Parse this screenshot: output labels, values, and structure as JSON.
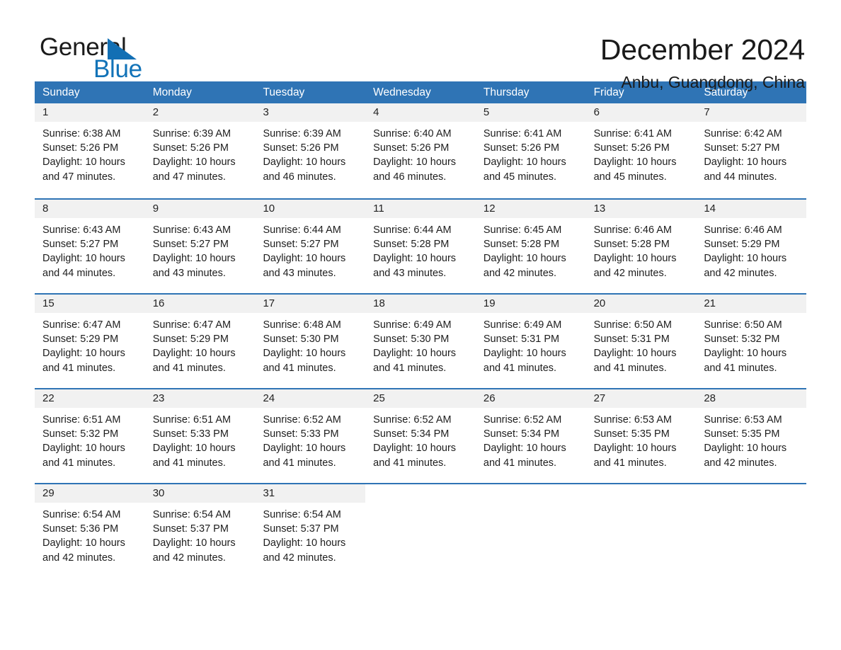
{
  "brand": {
    "word_one": "General",
    "word_two": "Blue",
    "triangle_color": "#126fb4",
    "blue_text_color": "#1273b8"
  },
  "header": {
    "month_title": "December 2024",
    "location": "Anbu, Guangdong, China"
  },
  "colors": {
    "header_blue": "#2f74b5",
    "day_band_gray": "#f1f1f1",
    "text": "#1d1d1d"
  },
  "calendar": {
    "weekdays": [
      "Sunday",
      "Monday",
      "Tuesday",
      "Wednesday",
      "Thursday",
      "Friday",
      "Saturday"
    ],
    "weeks": [
      [
        {
          "day": "1",
          "sunrise": "Sunrise: 6:38 AM",
          "sunset": "Sunset: 5:26 PM",
          "daylight_line1": "Daylight: 10 hours",
          "daylight_line2": "and 47 minutes."
        },
        {
          "day": "2",
          "sunrise": "Sunrise: 6:39 AM",
          "sunset": "Sunset: 5:26 PM",
          "daylight_line1": "Daylight: 10 hours",
          "daylight_line2": "and 47 minutes."
        },
        {
          "day": "3",
          "sunrise": "Sunrise: 6:39 AM",
          "sunset": "Sunset: 5:26 PM",
          "daylight_line1": "Daylight: 10 hours",
          "daylight_line2": "and 46 minutes."
        },
        {
          "day": "4",
          "sunrise": "Sunrise: 6:40 AM",
          "sunset": "Sunset: 5:26 PM",
          "daylight_line1": "Daylight: 10 hours",
          "daylight_line2": "and 46 minutes."
        },
        {
          "day": "5",
          "sunrise": "Sunrise: 6:41 AM",
          "sunset": "Sunset: 5:26 PM",
          "daylight_line1": "Daylight: 10 hours",
          "daylight_line2": "and 45 minutes."
        },
        {
          "day": "6",
          "sunrise": "Sunrise: 6:41 AM",
          "sunset": "Sunset: 5:26 PM",
          "daylight_line1": "Daylight: 10 hours",
          "daylight_line2": "and 45 minutes."
        },
        {
          "day": "7",
          "sunrise": "Sunrise: 6:42 AM",
          "sunset": "Sunset: 5:27 PM",
          "daylight_line1": "Daylight: 10 hours",
          "daylight_line2": "and 44 minutes."
        }
      ],
      [
        {
          "day": "8",
          "sunrise": "Sunrise: 6:43 AM",
          "sunset": "Sunset: 5:27 PM",
          "daylight_line1": "Daylight: 10 hours",
          "daylight_line2": "and 44 minutes."
        },
        {
          "day": "9",
          "sunrise": "Sunrise: 6:43 AM",
          "sunset": "Sunset: 5:27 PM",
          "daylight_line1": "Daylight: 10 hours",
          "daylight_line2": "and 43 minutes."
        },
        {
          "day": "10",
          "sunrise": "Sunrise: 6:44 AM",
          "sunset": "Sunset: 5:27 PM",
          "daylight_line1": "Daylight: 10 hours",
          "daylight_line2": "and 43 minutes."
        },
        {
          "day": "11",
          "sunrise": "Sunrise: 6:44 AM",
          "sunset": "Sunset: 5:28 PM",
          "daylight_line1": "Daylight: 10 hours",
          "daylight_line2": "and 43 minutes."
        },
        {
          "day": "12",
          "sunrise": "Sunrise: 6:45 AM",
          "sunset": "Sunset: 5:28 PM",
          "daylight_line1": "Daylight: 10 hours",
          "daylight_line2": "and 42 minutes."
        },
        {
          "day": "13",
          "sunrise": "Sunrise: 6:46 AM",
          "sunset": "Sunset: 5:28 PM",
          "daylight_line1": "Daylight: 10 hours",
          "daylight_line2": "and 42 minutes."
        },
        {
          "day": "14",
          "sunrise": "Sunrise: 6:46 AM",
          "sunset": "Sunset: 5:29 PM",
          "daylight_line1": "Daylight: 10 hours",
          "daylight_line2": "and 42 minutes."
        }
      ],
      [
        {
          "day": "15",
          "sunrise": "Sunrise: 6:47 AM",
          "sunset": "Sunset: 5:29 PM",
          "daylight_line1": "Daylight: 10 hours",
          "daylight_line2": "and 41 minutes."
        },
        {
          "day": "16",
          "sunrise": "Sunrise: 6:47 AM",
          "sunset": "Sunset: 5:29 PM",
          "daylight_line1": "Daylight: 10 hours",
          "daylight_line2": "and 41 minutes."
        },
        {
          "day": "17",
          "sunrise": "Sunrise: 6:48 AM",
          "sunset": "Sunset: 5:30 PM",
          "daylight_line1": "Daylight: 10 hours",
          "daylight_line2": "and 41 minutes."
        },
        {
          "day": "18",
          "sunrise": "Sunrise: 6:49 AM",
          "sunset": "Sunset: 5:30 PM",
          "daylight_line1": "Daylight: 10 hours",
          "daylight_line2": "and 41 minutes."
        },
        {
          "day": "19",
          "sunrise": "Sunrise: 6:49 AM",
          "sunset": "Sunset: 5:31 PM",
          "daylight_line1": "Daylight: 10 hours",
          "daylight_line2": "and 41 minutes."
        },
        {
          "day": "20",
          "sunrise": "Sunrise: 6:50 AM",
          "sunset": "Sunset: 5:31 PM",
          "daylight_line1": "Daylight: 10 hours",
          "daylight_line2": "and 41 minutes."
        },
        {
          "day": "21",
          "sunrise": "Sunrise: 6:50 AM",
          "sunset": "Sunset: 5:32 PM",
          "daylight_line1": "Daylight: 10 hours",
          "daylight_line2": "and 41 minutes."
        }
      ],
      [
        {
          "day": "22",
          "sunrise": "Sunrise: 6:51 AM",
          "sunset": "Sunset: 5:32 PM",
          "daylight_line1": "Daylight: 10 hours",
          "daylight_line2": "and 41 minutes."
        },
        {
          "day": "23",
          "sunrise": "Sunrise: 6:51 AM",
          "sunset": "Sunset: 5:33 PM",
          "daylight_line1": "Daylight: 10 hours",
          "daylight_line2": "and 41 minutes."
        },
        {
          "day": "24",
          "sunrise": "Sunrise: 6:52 AM",
          "sunset": "Sunset: 5:33 PM",
          "daylight_line1": "Daylight: 10 hours",
          "daylight_line2": "and 41 minutes."
        },
        {
          "day": "25",
          "sunrise": "Sunrise: 6:52 AM",
          "sunset": "Sunset: 5:34 PM",
          "daylight_line1": "Daylight: 10 hours",
          "daylight_line2": "and 41 minutes."
        },
        {
          "day": "26",
          "sunrise": "Sunrise: 6:52 AM",
          "sunset": "Sunset: 5:34 PM",
          "daylight_line1": "Daylight: 10 hours",
          "daylight_line2": "and 41 minutes."
        },
        {
          "day": "27",
          "sunrise": "Sunrise: 6:53 AM",
          "sunset": "Sunset: 5:35 PM",
          "daylight_line1": "Daylight: 10 hours",
          "daylight_line2": "and 41 minutes."
        },
        {
          "day": "28",
          "sunrise": "Sunrise: 6:53 AM",
          "sunset": "Sunset: 5:35 PM",
          "daylight_line1": "Daylight: 10 hours",
          "daylight_line2": "and 42 minutes."
        }
      ],
      [
        {
          "day": "29",
          "sunrise": "Sunrise: 6:54 AM",
          "sunset": "Sunset: 5:36 PM",
          "daylight_line1": "Daylight: 10 hours",
          "daylight_line2": "and 42 minutes."
        },
        {
          "day": "30",
          "sunrise": "Sunrise: 6:54 AM",
          "sunset": "Sunset: 5:37 PM",
          "daylight_line1": "Daylight: 10 hours",
          "daylight_line2": "and 42 minutes."
        },
        {
          "day": "31",
          "sunrise": "Sunrise: 6:54 AM",
          "sunset": "Sunset: 5:37 PM",
          "daylight_line1": "Daylight: 10 hours",
          "daylight_line2": "and 42 minutes."
        },
        {
          "day": "",
          "sunrise": "",
          "sunset": "",
          "daylight_line1": "",
          "daylight_line2": ""
        },
        {
          "day": "",
          "sunrise": "",
          "sunset": "",
          "daylight_line1": "",
          "daylight_line2": ""
        },
        {
          "day": "",
          "sunrise": "",
          "sunset": "",
          "daylight_line1": "",
          "daylight_line2": ""
        },
        {
          "day": "",
          "sunrise": "",
          "sunset": "",
          "daylight_line1": "",
          "daylight_line2": ""
        }
      ]
    ]
  }
}
